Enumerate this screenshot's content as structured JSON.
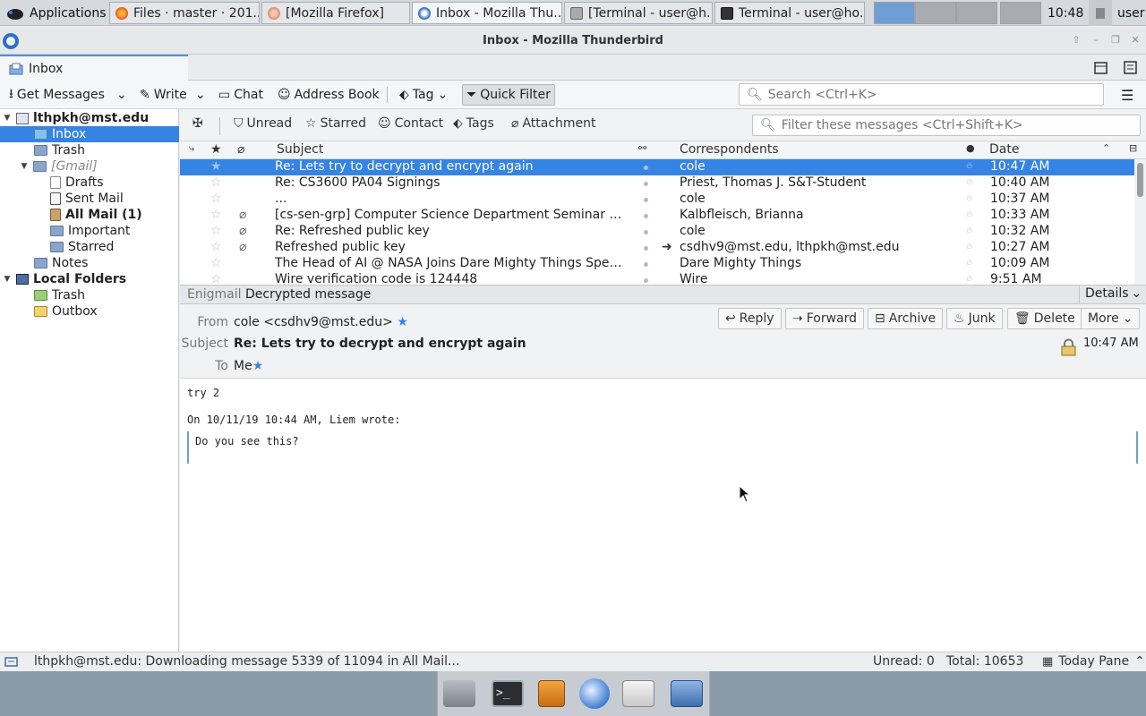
{
  "taskbar": {
    "applications": "Applications",
    "tasks": [
      "Files · master · 201...",
      "[Mozilla Firefox]",
      "Inbox - Mozilla Thu...",
      "[Terminal - user@h...",
      "Terminal - user@ho..."
    ],
    "clock": "10:48",
    "user": "user"
  },
  "window": {
    "title": "Inbox - Mozilla Thunderbird"
  },
  "tabs": {
    "inbox": "Inbox"
  },
  "toolbar": {
    "get_messages": "Get Messages",
    "write": "Write",
    "chat": "Chat",
    "address_book": "Address Book",
    "tag": "Tag",
    "quick_filter": "Quick Filter",
    "search_placeholder": "Search <Ctrl+K>"
  },
  "folders": {
    "account": "lthpkh@mst.edu",
    "inbox": "Inbox",
    "trash": "Trash",
    "gmail": "[Gmail]",
    "drafts": "Drafts",
    "sent": "Sent Mail",
    "allmail": "All Mail (1)",
    "important": "Important",
    "starred": "Starred",
    "notes": "Notes",
    "local": "Local Folders",
    "local_trash": "Trash",
    "outbox": "Outbox"
  },
  "quickfilter": {
    "unread": "Unread",
    "starred": "Starred",
    "contact": "Contact",
    "tags": "Tags",
    "attachment": "Attachment",
    "filter_placeholder": "Filter these messages <Ctrl+Shift+K>"
  },
  "columns": {
    "subject": "Subject",
    "correspondents": "Correspondents",
    "date": "Date"
  },
  "messages": [
    {
      "subject": "Re: Lets try to decrypt and encrypt again",
      "from": "cole",
      "date": "10:47 AM",
      "attach": false,
      "sent": false
    },
    {
      "subject": "Re: CS3600 PA04 Signings",
      "from": "Priest, Thomas J. S&T-Student",
      "date": "10:40 AM",
      "attach": false,
      "sent": false
    },
    {
      "subject": "...",
      "from": "cole",
      "date": "10:37 AM",
      "attach": false,
      "sent": false
    },
    {
      "subject": "[cs-sen-grp] Computer Science Department Seminar Octob...",
      "from": "Kalbfleisch, Brianna",
      "date": "10:33 AM",
      "attach": true,
      "sent": false
    },
    {
      "subject": "Re: Refreshed public key",
      "from": "cole",
      "date": "10:32 AM",
      "attach": true,
      "sent": false
    },
    {
      "subject": "Refreshed public key",
      "from": "csdhv9@mst.edu, lthpkh@mst.edu",
      "date": "10:27 AM",
      "attach": true,
      "sent": true
    },
    {
      "subject": "The Head of AI @ NASA Joins Dare Mighty Things Speaker ...",
      "from": "Dare Mighty Things",
      "date": "10:09 AM",
      "attach": false,
      "sent": false
    },
    {
      "subject": "Wire verification code is 124448",
      "from": "Wire",
      "date": "9:51 AM",
      "attach": false,
      "sent": false
    }
  ],
  "enigmail": {
    "label": "Enigmail",
    "status": "Decrypted message",
    "details": "Details"
  },
  "header": {
    "from_label": "From",
    "from": "cole <csdhv9@mst.edu>",
    "subject_label": "Subject",
    "subject": "Re: Lets try to decrypt and encrypt again",
    "to_label": "To",
    "to": "Me",
    "time": "10:47 AM",
    "reply": "Reply",
    "forward": "Forward",
    "archive": "Archive",
    "junk": "Junk",
    "delete": "Delete",
    "more": "More"
  },
  "body": {
    "line1": "try 2",
    "attribution": "On 10/11/19 10:44 AM, Liem wrote:",
    "quote": "Do you see this?"
  },
  "status": {
    "text": "lthpkh@mst.edu: Downloading message 5339 of 11094 in All Mail...",
    "unread": "Unread: 0",
    "total": "Total: 10653",
    "today_pane": "Today Pane"
  }
}
